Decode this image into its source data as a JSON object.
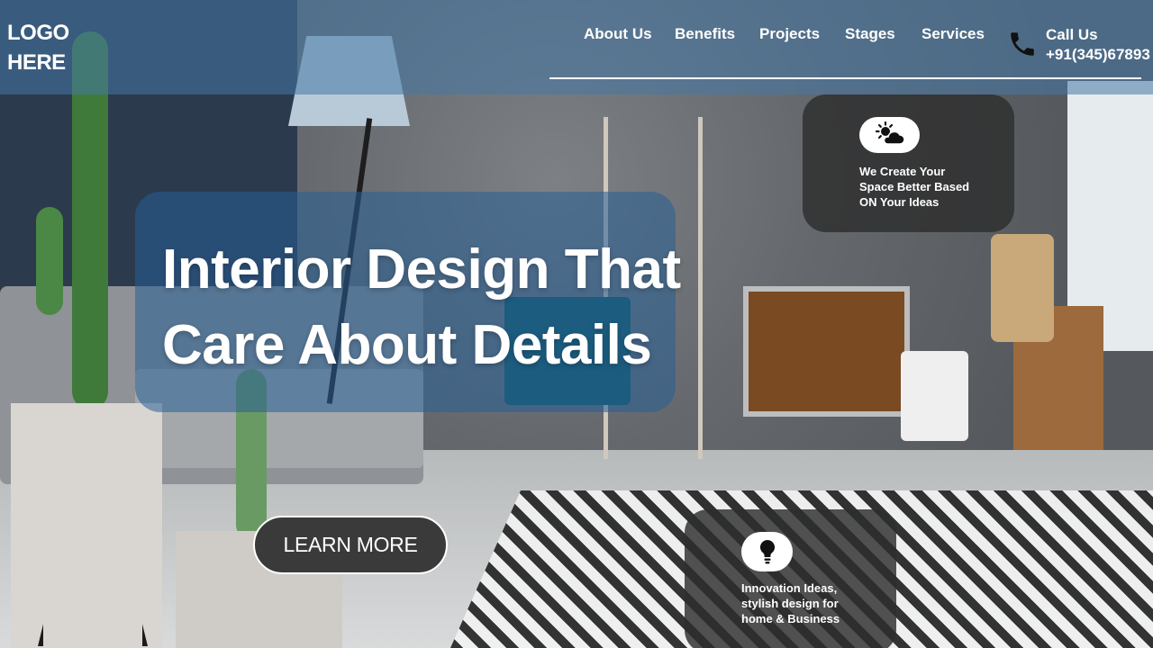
{
  "header": {
    "logo_line1": "LOGO",
    "logo_line2": "HERE",
    "nav": [
      {
        "label": "About Us"
      },
      {
        "label": "Benefits"
      },
      {
        "label": "Projects"
      },
      {
        "label": "Stages"
      },
      {
        "label": "Services"
      }
    ],
    "call_label": "Call Us",
    "call_phone": "+91(345)67893"
  },
  "hero": {
    "title_line1": "Interior Design That",
    "title_line2": "Care About Details",
    "cta_label": "LEARN MORE"
  },
  "features": [
    {
      "icon": "sun-cloud-icon",
      "line1": "We Create Your",
      "line2": "Space Better Based",
      "line3": "ON Your Ideas"
    },
    {
      "icon": "lightbulb-icon",
      "line1": "Innovation Ideas,",
      "line2": "stylish design for",
      "line3": "home & Business"
    }
  ],
  "colors": {
    "header_overlay": "#4678a5",
    "hero_panel": "#285f96",
    "card_bg": "#2d2d2d",
    "text": "#ffffff"
  }
}
